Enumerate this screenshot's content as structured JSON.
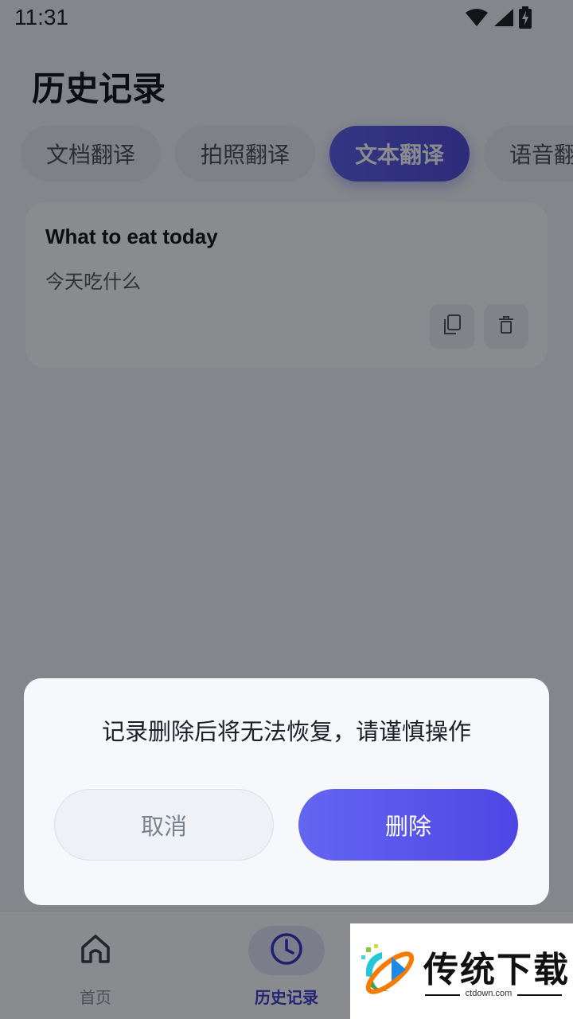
{
  "status_bar": {
    "time": "11:31",
    "icons": [
      "wifi-icon",
      "signal-icon",
      "battery-charging-icon"
    ]
  },
  "header": {
    "title": "历史记录"
  },
  "tabs": [
    {
      "label": "文档翻译",
      "active": false
    },
    {
      "label": "拍照翻译",
      "active": false
    },
    {
      "label": "文本翻译",
      "active": true
    },
    {
      "label": "语音翻译",
      "active": false
    }
  ],
  "record": {
    "source_text": "What to eat today",
    "translated_text": "今天吃什么",
    "actions": [
      "copy-icon",
      "trash-icon"
    ]
  },
  "bottom_nav": {
    "items": [
      {
        "label": "首页",
        "icon": "home-icon",
        "active": false
      },
      {
        "label": "历史记录",
        "icon": "clock-icon",
        "active": true
      }
    ]
  },
  "dialog": {
    "message": "记录删除后将无法恢复，请谨慎操作",
    "cancel_label": "取消",
    "confirm_label": "删除"
  },
  "watermark": {
    "title": "传统下载",
    "subtitle": "ctdown.com"
  },
  "colors": {
    "accent": "#4f46e5",
    "scrim": "#0a0c12"
  }
}
